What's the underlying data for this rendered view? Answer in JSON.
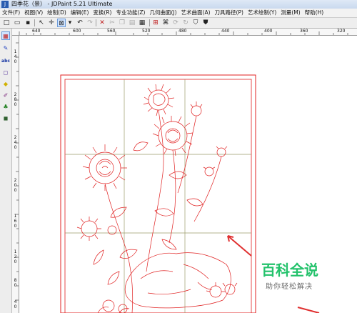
{
  "window": {
    "title": "四季花（景） - JDPaint 5.21 Ultimate",
    "app_icon": "jdpaint-app-icon"
  },
  "menu": [
    "文件(F)",
    "视图(V)",
    "绘制(D)",
    "编辑(E)",
    "变换(R)",
    "专业功能(Z)",
    "几何曲面(J)",
    "艺术曲面(A)",
    "刀具路径(P)",
    "艺术绘制(Y)",
    "测量(M)",
    "帮助(H)"
  ],
  "toolbar": {
    "buttons": [
      {
        "name": "new-file-icon",
        "glyph": "□"
      },
      {
        "name": "open-folder-icon",
        "glyph": "▭"
      },
      {
        "name": "save-icon",
        "glyph": "▪"
      },
      {
        "name": "select-arrow-icon",
        "glyph": "↖"
      },
      {
        "name": "crosshair-icon",
        "glyph": "✛"
      },
      {
        "name": "zoom-box-icon",
        "glyph": "⊠"
      },
      {
        "name": "dropdown-icon",
        "glyph": "▾"
      },
      {
        "name": "undo-icon",
        "glyph": "↶"
      },
      {
        "name": "redo-icon",
        "glyph": "↷"
      },
      {
        "name": "delete-icon",
        "glyph": "✕"
      },
      {
        "name": "cut-icon",
        "glyph": "✂"
      },
      {
        "name": "copy-icon",
        "glyph": "❐"
      },
      {
        "name": "paste-icon",
        "glyph": "▤"
      },
      {
        "name": "properties-icon",
        "glyph": "▦"
      },
      {
        "name": "grid-icon",
        "glyph": "⊞"
      },
      {
        "name": "snap-icon",
        "glyph": "⌘"
      },
      {
        "name": "transform-icon",
        "glyph": "⟳"
      },
      {
        "name": "rotate-icon",
        "glyph": "↻"
      },
      {
        "name": "shield-a-icon",
        "glyph": "⛉"
      },
      {
        "name": "shield-b-icon",
        "glyph": "⛊"
      }
    ]
  },
  "tools": [
    {
      "name": "select-grid-tool-icon",
      "glyph": "▦"
    },
    {
      "name": "pen-tool-icon",
      "glyph": "✎"
    },
    {
      "name": "text-tool-icon",
      "glyph": "abc"
    },
    {
      "name": "rectangle-tool-icon",
      "glyph": "◻"
    },
    {
      "name": "fill-tool-icon",
      "glyph": "◆"
    },
    {
      "name": "brush-tool-icon",
      "glyph": "✐"
    },
    {
      "name": "tree-tool-icon",
      "glyph": "♣"
    },
    {
      "name": "tool-8-icon",
      "glyph": "◼"
    }
  ],
  "ruler": {
    "h_labels": [
      "640",
      "600",
      "560",
      "520",
      "480",
      "440",
      "400",
      "360",
      "320"
    ],
    "v_labels": [
      "1",
      "4",
      "0",
      "2",
      "8",
      "0",
      "2",
      "4",
      "0",
      "2",
      "0",
      "0",
      "1",
      "6",
      "0",
      "1",
      "2",
      "0",
      "8",
      "0",
      "4",
      "0"
    ]
  },
  "colors": {
    "drawing_line": "#e02020",
    "grid_line": "#9a9a6a",
    "arrow": "#e03030",
    "brand_green": "#23c26b"
  },
  "watermark": {
    "title": "百科全说",
    "subtitle": "助你轻松解决"
  }
}
